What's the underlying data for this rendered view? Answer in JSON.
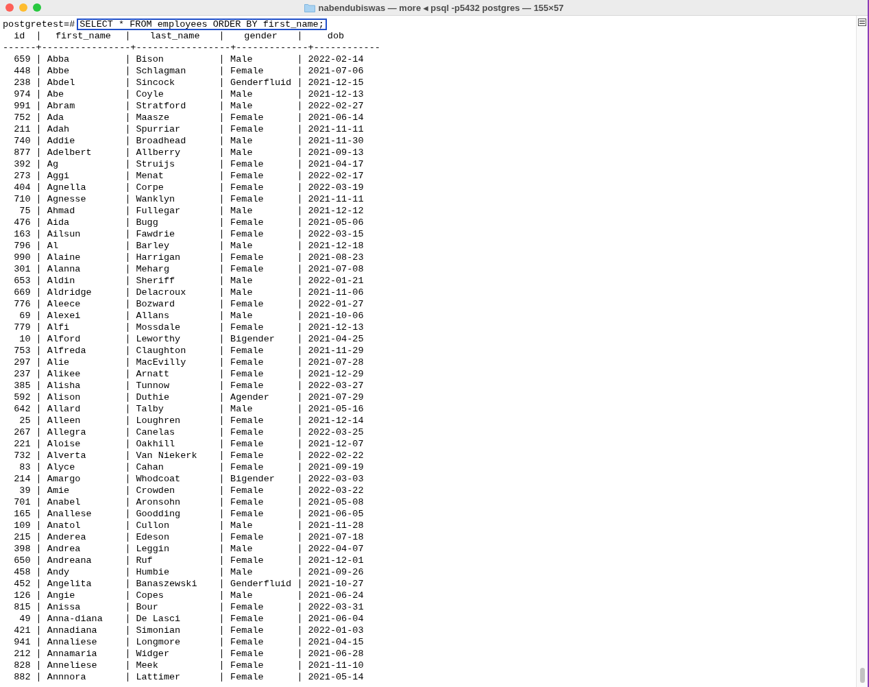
{
  "window": {
    "title": "nabendubiswas — more ◂ psql -p5432 postgres — 155×57"
  },
  "terminal": {
    "prompt": "postgretest=#",
    "command": "SELECT * FROM employees ORDER BY first_name;",
    "table": {
      "columns": [
        "id",
        "first_name",
        "last_name",
        "gender",
        "dob"
      ],
      "separator": "------+----------------+-----------------+-------------+------------",
      "rows": [
        [
          "659",
          "Abba",
          "Bison",
          "Male",
          "2022-02-14"
        ],
        [
          "448",
          "Abbe",
          "Schlagman",
          "Female",
          "2021-07-06"
        ],
        [
          "238",
          "Abdel",
          "Sincock",
          "Genderfluid",
          "2021-12-15"
        ],
        [
          "974",
          "Abe",
          "Coyle",
          "Male",
          "2021-12-13"
        ],
        [
          "991",
          "Abram",
          "Stratford",
          "Male",
          "2022-02-27"
        ],
        [
          "752",
          "Ada",
          "Maasze",
          "Female",
          "2021-06-14"
        ],
        [
          "211",
          "Adah",
          "Spurriar",
          "Female",
          "2021-11-11"
        ],
        [
          "740",
          "Addie",
          "Broadhead",
          "Male",
          "2021-11-30"
        ],
        [
          "877",
          "Adelbert",
          "Allberry",
          "Male",
          "2021-09-13"
        ],
        [
          "392",
          "Ag",
          "Struijs",
          "Female",
          "2021-04-17"
        ],
        [
          "273",
          "Aggi",
          "Menat",
          "Female",
          "2022-02-17"
        ],
        [
          "404",
          "Agnella",
          "Corpe",
          "Female",
          "2022-03-19"
        ],
        [
          "710",
          "Agnesse",
          "Wanklyn",
          "Female",
          "2021-11-11"
        ],
        [
          "75",
          "Ahmad",
          "Fullegar",
          "Male",
          "2021-12-12"
        ],
        [
          "476",
          "Aida",
          "Bugg",
          "Female",
          "2021-05-06"
        ],
        [
          "163",
          "Ailsun",
          "Fawdrie",
          "Female",
          "2022-03-15"
        ],
        [
          "796",
          "Al",
          "Barley",
          "Male",
          "2021-12-18"
        ],
        [
          "990",
          "Alaine",
          "Harrigan",
          "Female",
          "2021-08-23"
        ],
        [
          "301",
          "Alanna",
          "Meharg",
          "Female",
          "2021-07-08"
        ],
        [
          "653",
          "Aldin",
          "Sheriff",
          "Male",
          "2022-01-21"
        ],
        [
          "669",
          "Aldridge",
          "Delacroux",
          "Male",
          "2021-11-06"
        ],
        [
          "776",
          "Aleece",
          "Bozward",
          "Female",
          "2022-01-27"
        ],
        [
          "69",
          "Alexei",
          "Allans",
          "Male",
          "2021-10-06"
        ],
        [
          "779",
          "Alfi",
          "Mossdale",
          "Female",
          "2021-12-13"
        ],
        [
          "10",
          "Alford",
          "Leworthy",
          "Bigender",
          "2021-04-25"
        ],
        [
          "753",
          "Alfreda",
          "Claughton",
          "Female",
          "2021-11-29"
        ],
        [
          "297",
          "Alie",
          "MacEvilly",
          "Female",
          "2021-07-28"
        ],
        [
          "237",
          "Alikee",
          "Arnatt",
          "Female",
          "2021-12-29"
        ],
        [
          "385",
          "Alisha",
          "Tunnow",
          "Female",
          "2022-03-27"
        ],
        [
          "592",
          "Alison",
          "Duthie",
          "Agender",
          "2021-07-29"
        ],
        [
          "642",
          "Allard",
          "Talby",
          "Male",
          "2021-05-16"
        ],
        [
          "25",
          "Alleen",
          "Loughren",
          "Female",
          "2021-12-14"
        ],
        [
          "267",
          "Allegra",
          "Canelas",
          "Female",
          "2022-03-25"
        ],
        [
          "221",
          "Aloise",
          "Oakhill",
          "Female",
          "2021-12-07"
        ],
        [
          "732",
          "Alverta",
          "Van Niekerk",
          "Female",
          "2022-02-22"
        ],
        [
          "83",
          "Alyce",
          "Cahan",
          "Female",
          "2021-09-19"
        ],
        [
          "214",
          "Amargo",
          "Whodcoat",
          "Bigender",
          "2022-03-03"
        ],
        [
          "39",
          "Amie",
          "Crowden",
          "Female",
          "2022-03-22"
        ],
        [
          "701",
          "Anabel",
          "Aronsohn",
          "Female",
          "2021-05-08"
        ],
        [
          "165",
          "Anallese",
          "Goodding",
          "Female",
          "2021-06-05"
        ],
        [
          "109",
          "Anatol",
          "Cullon",
          "Male",
          "2021-11-28"
        ],
        [
          "215",
          "Anderea",
          "Edeson",
          "Female",
          "2021-07-18"
        ],
        [
          "398",
          "Andrea",
          "Leggin",
          "Male",
          "2022-04-07"
        ],
        [
          "650",
          "Andreana",
          "Ruf",
          "Female",
          "2021-12-01"
        ],
        [
          "458",
          "Andy",
          "Humbie",
          "Male",
          "2021-09-26"
        ],
        [
          "452",
          "Angelita",
          "Banaszewski",
          "Genderfluid",
          "2021-10-27"
        ],
        [
          "126",
          "Angie",
          "Copes",
          "Male",
          "2021-06-24"
        ],
        [
          "815",
          "Anissa",
          "Bour",
          "Female",
          "2022-03-31"
        ],
        [
          "49",
          "Anna-diana",
          "De Lasci",
          "Female",
          "2021-06-04"
        ],
        [
          "421",
          "Annadiana",
          "Simonian",
          "Female",
          "2022-01-03"
        ],
        [
          "941",
          "Annaliese",
          "Longmore",
          "Female",
          "2021-04-15"
        ],
        [
          "212",
          "Annamaria",
          "Widger",
          "Female",
          "2021-06-28"
        ],
        [
          "828",
          "Anneliese",
          "Meek",
          "Female",
          "2021-11-10"
        ],
        [
          "882",
          "Annnora",
          "Lattimer",
          "Female",
          "2021-05-14"
        ]
      ]
    }
  }
}
